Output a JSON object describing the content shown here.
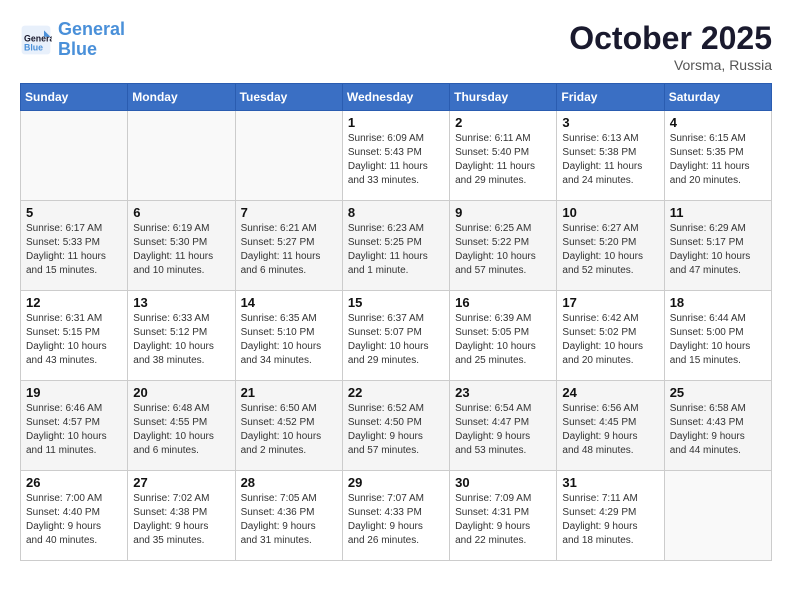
{
  "logo": {
    "line1": "General",
    "line2": "Blue"
  },
  "title": "October 2025",
  "location": "Vorsma, Russia",
  "days_of_week": [
    "Sunday",
    "Monday",
    "Tuesday",
    "Wednesday",
    "Thursday",
    "Friday",
    "Saturday"
  ],
  "weeks": [
    [
      {
        "day": "",
        "text": ""
      },
      {
        "day": "",
        "text": ""
      },
      {
        "day": "",
        "text": ""
      },
      {
        "day": "1",
        "text": "Sunrise: 6:09 AM\nSunset: 5:43 PM\nDaylight: 11 hours\nand 33 minutes."
      },
      {
        "day": "2",
        "text": "Sunrise: 6:11 AM\nSunset: 5:40 PM\nDaylight: 11 hours\nand 29 minutes."
      },
      {
        "day": "3",
        "text": "Sunrise: 6:13 AM\nSunset: 5:38 PM\nDaylight: 11 hours\nand 24 minutes."
      },
      {
        "day": "4",
        "text": "Sunrise: 6:15 AM\nSunset: 5:35 PM\nDaylight: 11 hours\nand 20 minutes."
      }
    ],
    [
      {
        "day": "5",
        "text": "Sunrise: 6:17 AM\nSunset: 5:33 PM\nDaylight: 11 hours\nand 15 minutes."
      },
      {
        "day": "6",
        "text": "Sunrise: 6:19 AM\nSunset: 5:30 PM\nDaylight: 11 hours\nand 10 minutes."
      },
      {
        "day": "7",
        "text": "Sunrise: 6:21 AM\nSunset: 5:27 PM\nDaylight: 11 hours\nand 6 minutes."
      },
      {
        "day": "8",
        "text": "Sunrise: 6:23 AM\nSunset: 5:25 PM\nDaylight: 11 hours\nand 1 minute."
      },
      {
        "day": "9",
        "text": "Sunrise: 6:25 AM\nSunset: 5:22 PM\nDaylight: 10 hours\nand 57 minutes."
      },
      {
        "day": "10",
        "text": "Sunrise: 6:27 AM\nSunset: 5:20 PM\nDaylight: 10 hours\nand 52 minutes."
      },
      {
        "day": "11",
        "text": "Sunrise: 6:29 AM\nSunset: 5:17 PM\nDaylight: 10 hours\nand 47 minutes."
      }
    ],
    [
      {
        "day": "12",
        "text": "Sunrise: 6:31 AM\nSunset: 5:15 PM\nDaylight: 10 hours\nand 43 minutes."
      },
      {
        "day": "13",
        "text": "Sunrise: 6:33 AM\nSunset: 5:12 PM\nDaylight: 10 hours\nand 38 minutes."
      },
      {
        "day": "14",
        "text": "Sunrise: 6:35 AM\nSunset: 5:10 PM\nDaylight: 10 hours\nand 34 minutes."
      },
      {
        "day": "15",
        "text": "Sunrise: 6:37 AM\nSunset: 5:07 PM\nDaylight: 10 hours\nand 29 minutes."
      },
      {
        "day": "16",
        "text": "Sunrise: 6:39 AM\nSunset: 5:05 PM\nDaylight: 10 hours\nand 25 minutes."
      },
      {
        "day": "17",
        "text": "Sunrise: 6:42 AM\nSunset: 5:02 PM\nDaylight: 10 hours\nand 20 minutes."
      },
      {
        "day": "18",
        "text": "Sunrise: 6:44 AM\nSunset: 5:00 PM\nDaylight: 10 hours\nand 15 minutes."
      }
    ],
    [
      {
        "day": "19",
        "text": "Sunrise: 6:46 AM\nSunset: 4:57 PM\nDaylight: 10 hours\nand 11 minutes."
      },
      {
        "day": "20",
        "text": "Sunrise: 6:48 AM\nSunset: 4:55 PM\nDaylight: 10 hours\nand 6 minutes."
      },
      {
        "day": "21",
        "text": "Sunrise: 6:50 AM\nSunset: 4:52 PM\nDaylight: 10 hours\nand 2 minutes."
      },
      {
        "day": "22",
        "text": "Sunrise: 6:52 AM\nSunset: 4:50 PM\nDaylight: 9 hours\nand 57 minutes."
      },
      {
        "day": "23",
        "text": "Sunrise: 6:54 AM\nSunset: 4:47 PM\nDaylight: 9 hours\nand 53 minutes."
      },
      {
        "day": "24",
        "text": "Sunrise: 6:56 AM\nSunset: 4:45 PM\nDaylight: 9 hours\nand 48 minutes."
      },
      {
        "day": "25",
        "text": "Sunrise: 6:58 AM\nSunset: 4:43 PM\nDaylight: 9 hours\nand 44 minutes."
      }
    ],
    [
      {
        "day": "26",
        "text": "Sunrise: 7:00 AM\nSunset: 4:40 PM\nDaylight: 9 hours\nand 40 minutes."
      },
      {
        "day": "27",
        "text": "Sunrise: 7:02 AM\nSunset: 4:38 PM\nDaylight: 9 hours\nand 35 minutes."
      },
      {
        "day": "28",
        "text": "Sunrise: 7:05 AM\nSunset: 4:36 PM\nDaylight: 9 hours\nand 31 minutes."
      },
      {
        "day": "29",
        "text": "Sunrise: 7:07 AM\nSunset: 4:33 PM\nDaylight: 9 hours\nand 26 minutes."
      },
      {
        "day": "30",
        "text": "Sunrise: 7:09 AM\nSunset: 4:31 PM\nDaylight: 9 hours\nand 22 minutes."
      },
      {
        "day": "31",
        "text": "Sunrise: 7:11 AM\nSunset: 4:29 PM\nDaylight: 9 hours\nand 18 minutes."
      },
      {
        "day": "",
        "text": ""
      }
    ]
  ]
}
